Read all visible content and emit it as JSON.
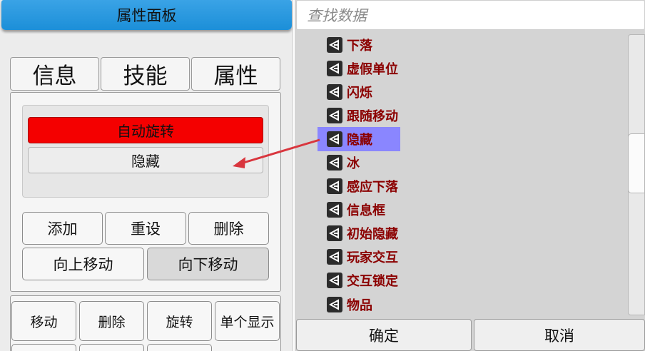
{
  "left_panel": {
    "title": "属性面板",
    "tabs": [
      {
        "label": "信息"
      },
      {
        "label": "技能"
      },
      {
        "label": "属性"
      }
    ],
    "list_items": [
      {
        "label": "自动旋转",
        "color": "#f40000"
      },
      {
        "label": "隐藏"
      }
    ],
    "action_buttons": {
      "add": "添加",
      "reset": "重设",
      "delete": "删除",
      "move_up": "向上移动",
      "move_down": "向下移动"
    },
    "bottom_buttons": {
      "move": "移动",
      "delete": "删除",
      "rotate": "旋转",
      "single_display": "单个显示"
    }
  },
  "right_panel": {
    "search_placeholder": "查找数据",
    "items": [
      {
        "label": "下落",
        "icon": "unity-icon"
      },
      {
        "label": "虚假单位",
        "icon": "unity-icon"
      },
      {
        "label": "闪烁",
        "icon": "unity-icon"
      },
      {
        "label": "跟随移动",
        "icon": "unity-icon"
      },
      {
        "label": "隐藏",
        "icon": "unity-icon",
        "selected": true
      },
      {
        "label": "冰",
        "icon": "unity-icon"
      },
      {
        "label": "感应下落",
        "icon": "unity-icon"
      },
      {
        "label": "信息框",
        "icon": "unity-icon"
      },
      {
        "label": "初始隐藏",
        "icon": "unity-icon"
      },
      {
        "label": "玩家交互",
        "icon": "unity-icon"
      },
      {
        "label": "交互锁定",
        "icon": "unity-icon"
      },
      {
        "label": "物品",
        "icon": "unity-icon"
      }
    ],
    "footer": {
      "confirm": "确定",
      "cancel": "取消"
    }
  },
  "colors": {
    "title_bar": "#1c8fd8",
    "item_text": "#8b0000",
    "selection": "#8a86ff",
    "annotation_arrow": "#d9363e"
  }
}
